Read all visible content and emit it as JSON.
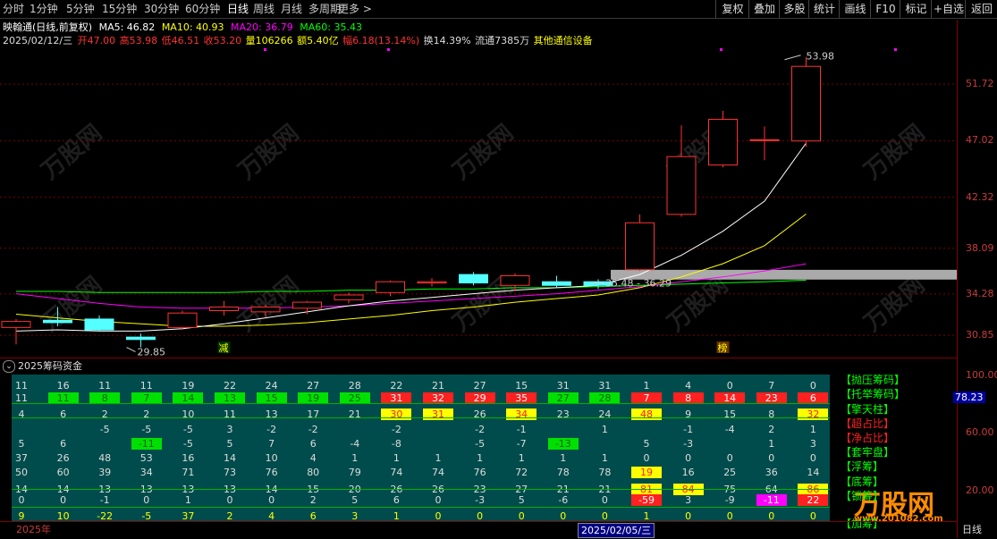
{
  "toolbar": {
    "tabs": [
      "分时",
      "1分钟",
      "5分钟",
      "15分钟",
      "30分钟",
      "60分钟",
      "日线",
      "周线",
      "月线",
      "多周期",
      "更多 >"
    ],
    "active_tab": "日线",
    "right_buttons": [
      "复权",
      "叠加",
      "多股",
      "统计",
      "画线",
      "F10",
      "标记",
      "+自选",
      "返回"
    ]
  },
  "stock": {
    "title": "映翰通(日线,前复权)",
    "ma5": "MA5: 46.82",
    "ma10": "MA10: 40.93",
    "ma20": "MA20: 36.79",
    "ma60": "MA60: 35.43",
    "date": "2025/02/12/三",
    "open": "开47.00",
    "high": "高53.98",
    "low": "低46.51",
    "close": "收53.20",
    "volume": "量106266",
    "amount": "额5.40亿",
    "change": "幅6.18(13.14%)",
    "turnover": "换14.39%",
    "float": "流通7385万",
    "industry": "其他通信设备"
  },
  "colors": {
    "up": "#ff3232",
    "down": "#54ffff",
    "ma5": "#ffffff",
    "ma10": "#ffff00",
    "ma20": "#ff00ff",
    "ma60": "#00ff00",
    "teal": "#004c4c",
    "axis_text": "#c83c3c"
  },
  "price_axis": {
    "labels": [
      "51.72",
      "47.02",
      "42.32",
      "38.09",
      "34.28",
      "30.85"
    ]
  },
  "chart_annotations": {
    "high_label": "53.98",
    "low_label": "29.85",
    "range_label": "35.48 - 36.29",
    "marker_jian": "减",
    "marker_bang": "榜"
  },
  "chart_data": {
    "type": "candlestick",
    "ohlc": [
      {
        "o": 31.5,
        "h": 32.2,
        "l": 30.1,
        "c": 32.0
      },
      {
        "o": 32.1,
        "h": 33.2,
        "l": 31.6,
        "c": 31.9
      },
      {
        "o": 32.2,
        "h": 32.5,
        "l": 31.2,
        "c": 31.3
      },
      {
        "o": 30.7,
        "h": 31.0,
        "l": 29.85,
        "c": 30.5
      },
      {
        "o": 31.5,
        "h": 32.9,
        "l": 31.3,
        "c": 32.7
      },
      {
        "o": 32.9,
        "h": 33.7,
        "l": 32.5,
        "c": 33.2
      },
      {
        "o": 32.8,
        "h": 33.4,
        "l": 32.4,
        "c": 33.2
      },
      {
        "o": 33.1,
        "h": 33.7,
        "l": 32.6,
        "c": 33.6
      },
      {
        "o": 33.8,
        "h": 34.4,
        "l": 33.5,
        "c": 34.2
      },
      {
        "o": 34.4,
        "h": 35.4,
        "l": 34.1,
        "c": 35.3
      },
      {
        "o": 35.2,
        "h": 35.6,
        "l": 34.9,
        "c": 35.3
      },
      {
        "o": 35.9,
        "h": 36.1,
        "l": 35.0,
        "c": 35.2
      },
      {
        "o": 35.0,
        "h": 36.0,
        "l": 34.5,
        "c": 35.8
      },
      {
        "o": 35.3,
        "h": 35.8,
        "l": 34.8,
        "c": 35.0
      },
      {
        "o": 35.3,
        "h": 35.5,
        "l": 34.7,
        "c": 35.0
      },
      {
        "o": 36.3,
        "h": 40.9,
        "l": 36.2,
        "c": 40.2
      },
      {
        "o": 40.9,
        "h": 48.3,
        "l": 40.7,
        "c": 45.7
      },
      {
        "o": 45.0,
        "h": 49.5,
        "l": 44.8,
        "c": 48.8
      },
      {
        "o": 47.1,
        "h": 48.2,
        "l": 45.4,
        "c": 47.1
      },
      {
        "o": 47.0,
        "h": 53.98,
        "l": 46.51,
        "c": 53.2
      }
    ],
    "ma5": [
      31.2,
      31.3,
      31.2,
      31.2,
      31.4,
      31.8,
      32.3,
      32.8,
      33.3,
      33.7,
      34.0,
      34.3,
      34.6,
      34.8,
      35.0,
      35.9,
      37.5,
      39.5,
      42.0,
      46.82
    ],
    "ma10": [
      32.6,
      32.3,
      32.0,
      31.8,
      31.6,
      31.6,
      31.7,
      31.9,
      32.2,
      32.5,
      32.9,
      33.2,
      33.6,
      33.9,
      34.2,
      34.8,
      35.7,
      36.8,
      38.3,
      40.93
    ],
    "ma20": [
      34.3,
      33.9,
      33.5,
      33.2,
      33.1,
      33.1,
      33.1,
      33.2,
      33.3,
      33.5,
      33.7,
      33.9,
      34.1,
      34.3,
      34.6,
      34.9,
      35.3,
      35.7,
      36.2,
      36.79
    ],
    "ma60": [
      34.5,
      34.5,
      34.4,
      34.4,
      34.4,
      34.4,
      34.5,
      34.5,
      34.6,
      34.6,
      34.7,
      34.7,
      34.8,
      34.8,
      34.9,
      35.0,
      35.1,
      35.2,
      35.3,
      35.43
    ],
    "ylim": [
      29.0,
      55.0
    ],
    "band": [
      35.48,
      36.29
    ]
  },
  "panel": {
    "title": "2025筹码资金",
    "rows": [
      {
        "label": "",
        "values": [
          "11",
          "16",
          "11",
          "11",
          "19",
          "22",
          "24",
          "27",
          "28",
          "22",
          "21",
          "27",
          "15",
          "31",
          "31",
          "1",
          "4",
          "0",
          "7",
          "0"
        ]
      },
      {
        "label": "【抛压筹码】",
        "values": [
          "11",
          "11",
          "8",
          "7",
          "14",
          "13",
          "15",
          "19",
          "25",
          "31",
          "32",
          "29",
          "35",
          "27",
          "28",
          "7",
          "8",
          "14",
          "23",
          "6"
        ]
      },
      {
        "label": "【托举筹码】",
        "values": [
          "4",
          "6",
          "2",
          "2",
          "10",
          "11",
          "13",
          "17",
          "21",
          "30",
          "31",
          "26",
          "34",
          "23",
          "24",
          "48",
          "9",
          "15",
          "8",
          "32"
        ]
      },
      {
        "label": "【擎天柱】",
        "values": [
          "",
          "",
          "-5",
          "-5",
          "-5",
          "3",
          "-2",
          "-2",
          "",
          "-2",
          "",
          "-2",
          "-1",
          "",
          "1",
          "",
          "-1",
          "-4",
          "2",
          "1"
        ]
      },
      {
        "label": "【超占比】",
        "values": [
          "5",
          "6",
          "",
          "-11",
          "-5",
          "5",
          "7",
          "6",
          "-4",
          "-8",
          "",
          "-5",
          "-7",
          "-13",
          "",
          "5",
          "-3",
          "",
          "1",
          "3"
        ]
      },
      {
        "label": "【净占比】",
        "values": [
          "37",
          "26",
          "48",
          "53",
          "16",
          "14",
          "10",
          "4",
          "1",
          "1",
          "1",
          "1",
          "1",
          "1",
          "1",
          "0",
          "0",
          "0",
          "0",
          "0"
        ]
      },
      {
        "label": "【套牢盘】",
        "values": [
          "50",
          "60",
          "39",
          "34",
          "71",
          "73",
          "76",
          "80",
          "79",
          "74",
          "74",
          "76",
          "72",
          "78",
          "78",
          "19",
          "16",
          "25",
          "36",
          "14"
        ]
      },
      {
        "label": "【浮筹】",
        "values": [
          "14",
          "14",
          "13",
          "13",
          "13",
          "13",
          "14",
          "15",
          "20",
          "26",
          "26",
          "23",
          "27",
          "21",
          "21",
          "81",
          "84",
          "75",
          "64",
          "86"
        ]
      },
      {
        "label": "【底筹】",
        "values": [
          "0",
          "0",
          "-1",
          "0",
          "1",
          "0",
          "0",
          "2",
          "5",
          "6",
          "0",
          "-3",
          "5",
          "-6",
          "0",
          "-59",
          "3",
          "-9",
          "-11",
          "22"
        ]
      },
      {
        "label": "【锁筹】",
        "values": [
          "9",
          "10",
          "-22",
          "-5",
          "37",
          "2",
          "4",
          "6",
          "3",
          "1",
          "0",
          "0",
          "0",
          "0",
          "0",
          "1",
          "0",
          "0",
          "0",
          "0"
        ]
      }
    ],
    "extra_labels": [
      "【加筹】"
    ],
    "right_axis": [
      "100.00",
      "78.23",
      "60.00",
      "20.00"
    ],
    "axis_value_highlight": "78.23",
    "footer_year": "2025年",
    "footer_date": "2025/02/05/三",
    "footer_right": "日线"
  },
  "watermark": {
    "text": "万股网",
    "url": "www.201082.com"
  }
}
